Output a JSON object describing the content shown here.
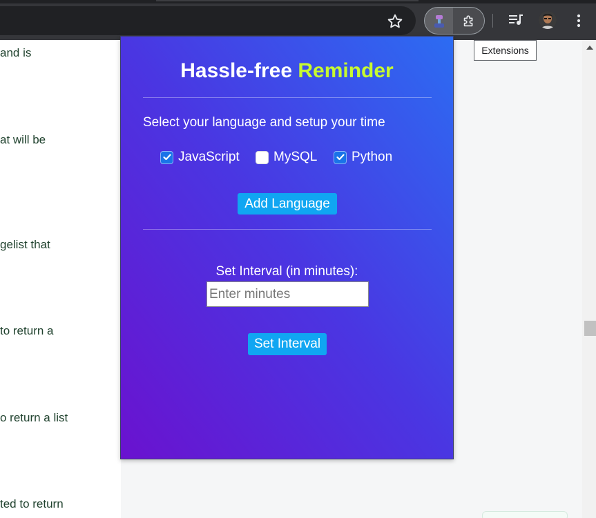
{
  "browser": {
    "star_icon": "star-outline",
    "active_extension_icon": "reminder-extension-icon",
    "extensions_icon": "puzzle-icon",
    "media_icon": "playlist-music-icon",
    "menu_icon": "three-dots-vertical-icon",
    "tooltip": "Extensions"
  },
  "page": {
    "snippets": [
      "and is",
      "at will be",
      "gelist that",
      " to return a",
      "o return a list",
      "ted to return"
    ]
  },
  "popup": {
    "title_main": "Hassle-free",
    "title_accent": "Reminder",
    "subtitle": "Select your language and setup your time",
    "languages": [
      {
        "label": "JavaScript",
        "checked": true
      },
      {
        "label": "MySQL",
        "checked": false
      },
      {
        "label": "Python",
        "checked": true
      }
    ],
    "add_button": "Add Language",
    "interval_label": "Set Interval (in minutes):",
    "minutes_placeholder": "Enter minutes",
    "set_button": "Set Interval"
  },
  "colors": {
    "gradient_start": "#6a12cf",
    "gradient_end": "#2c6cf2",
    "accent": "#c7fa30",
    "button": "#10a6f2",
    "checkbox": "#1a73e8"
  }
}
